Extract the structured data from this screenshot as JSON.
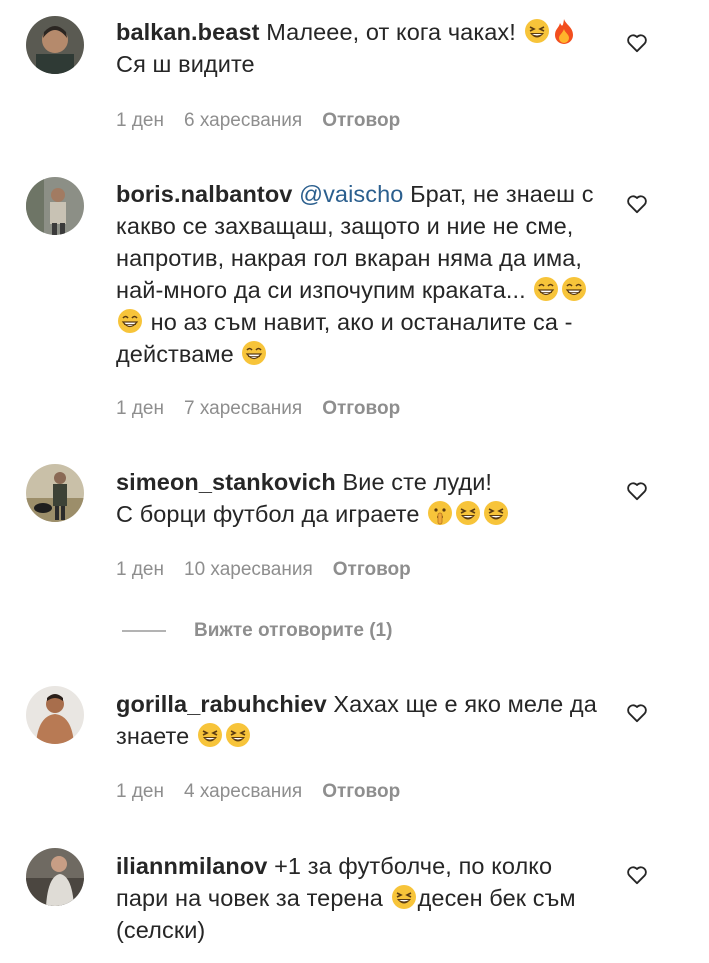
{
  "comments": [
    {
      "username": "balkan.beast",
      "mention": "",
      "text_lines": [
        "Малеее, от кога чаках!",
        "Ся ш видите"
      ],
      "time": "1 ден",
      "likes": "6 харесвания",
      "reply_label": "Отговор"
    },
    {
      "username": "boris.nalbantov",
      "mention": "@vaischo",
      "text": "Брат, не знаеш с какво се захващаш, защото и ние не сме, напротив, накрая гол вкаран няма да има, най-много да си изпочупим краката...",
      "text_after": "но аз съм навит, ако и останалите са - действаме",
      "time": "1 ден",
      "likes": "7 харесвания",
      "reply_label": "Отговор"
    },
    {
      "username": "simeon_stankovich",
      "text_line1": "Вие сте луди!",
      "text_line2": "С борци футбол да играете",
      "time": "1 ден",
      "likes": "10 харесвания",
      "reply_label": "Отговор",
      "view_replies": "Вижте отговорите (1)"
    },
    {
      "username": "gorilla_rabuhchiev",
      "text_line1": "Хахах ще е яко меле да",
      "text_line2": "знаете",
      "time": "1 ден",
      "likes": "4 харесвания",
      "reply_label": "Отговор"
    },
    {
      "username": "iliannmilanov",
      "text_line1": "+1 за футболче, по колко",
      "text_line2a": "пари на човек за терена",
      "text_line2b": "десен бек съм",
      "text_line3": "(селски)"
    }
  ],
  "icons": {
    "like": "heart-outline-icon",
    "emoji_laugh": "grinning-squinting-face",
    "emoji_fire": "fire",
    "emoji_grin": "beaming-face",
    "emoji_shush": "shushing-face"
  },
  "colors": {
    "text": "#262626",
    "meta": "#8e8e8e",
    "mention": "#2b5f8e",
    "emoji": "#f7c43a"
  }
}
